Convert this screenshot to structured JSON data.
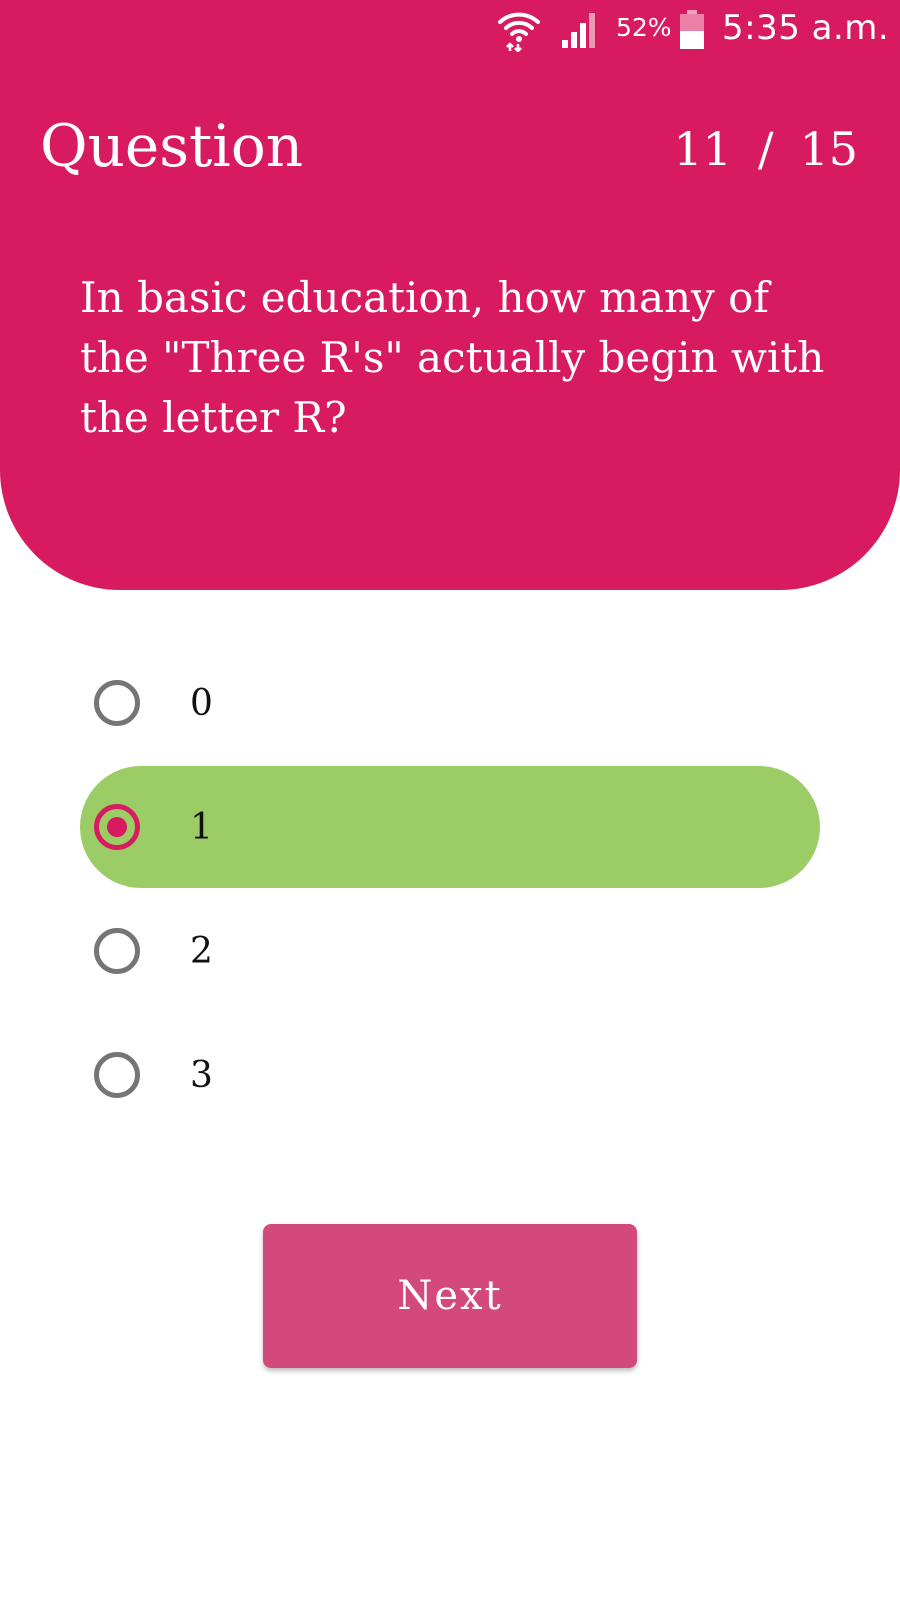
{
  "status_bar": {
    "battery_percent": "52%",
    "time": "5:35 a.m.",
    "icons": [
      "wifi-icon",
      "signal-icon",
      "battery-icon"
    ]
  },
  "header": {
    "title": "Question",
    "current": "11",
    "separator": "/",
    "total": "15"
  },
  "question": {
    "text": "In basic education, how many of the \"Three R's\" actually begin with the letter R?"
  },
  "options": [
    {
      "label": "0",
      "selected": false
    },
    {
      "label": "1",
      "selected": true
    },
    {
      "label": "2",
      "selected": false
    },
    {
      "label": "3",
      "selected": false
    }
  ],
  "next_button": {
    "label": "Next"
  },
  "colors": {
    "primary": "#d81b60",
    "button": "#d4497c",
    "selected_highlight": "#9ccc65",
    "radio_unselected": "#757575",
    "background": "#ffffff"
  }
}
